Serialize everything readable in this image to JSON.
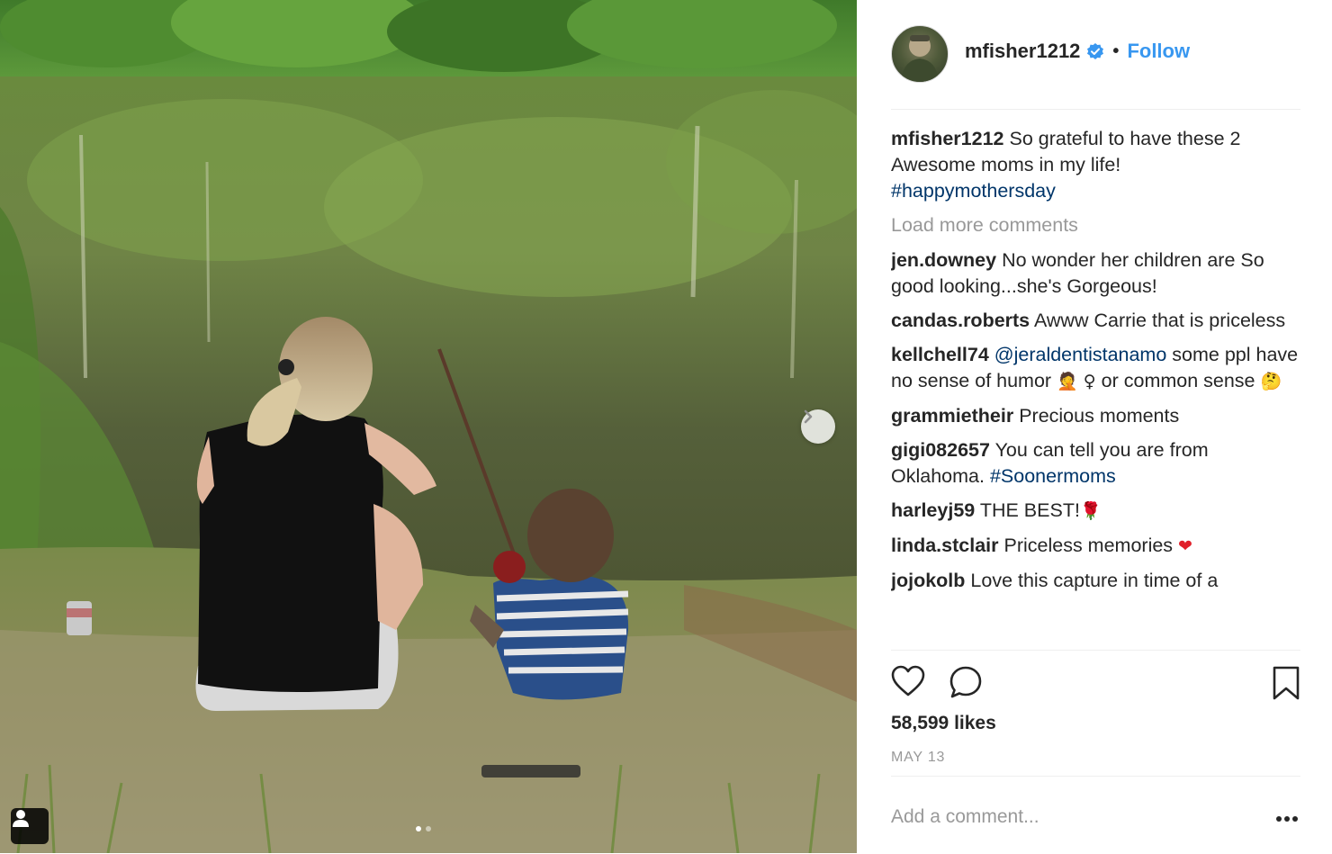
{
  "post": {
    "username": "mfisher1212",
    "separator": "•",
    "follow_label": "Follow",
    "caption_text": "So grateful to have these 2 Awesome moms in my life!",
    "caption_hashtag": "#happymothersday",
    "load_more_label": "Load more comments",
    "likes": "58,599 likes",
    "date": "MAY 13",
    "add_comment_placeholder": "Add a comment..."
  },
  "comments": [
    {
      "user": "jen.downey",
      "text": "No wonder her children are So good looking...she's Gorgeous!"
    },
    {
      "user": "candas.roberts",
      "text": "Awww Carrie that is priceless"
    },
    {
      "user": "kellchell74",
      "mention": "@jeraldentistanamo",
      "text": "some ppl have no sense of humor",
      "emoji1": "🤦",
      "emoji2": "♀",
      "text2": "or common sense",
      "emoji3": "🤔"
    },
    {
      "user": "grammietheir",
      "text": "Precious moments"
    },
    {
      "user": "gigi082657",
      "text": "You can tell you are from Oklahoma.",
      "hashtag": "#Soonermoms"
    },
    {
      "user": "harleyj59",
      "text": "THE BEST!",
      "emoji": "🌹"
    },
    {
      "user": "linda.stclair",
      "text": "Priceless memories",
      "emoji": "❤"
    },
    {
      "user": "jojokolb",
      "text": "Love this capture in time of a"
    }
  ],
  "icons": {
    "next": "chevron-right-icon",
    "user_tag": "person-icon",
    "like": "heart-icon",
    "comment": "speech-bubble-icon",
    "save": "bookmark-icon",
    "more": "more-options-icon",
    "verified": "verified-badge-icon"
  },
  "colors": {
    "accent": "#3897f0",
    "hashtag": "#003569",
    "muted": "#999999",
    "text": "#262626",
    "border": "#efefef"
  }
}
